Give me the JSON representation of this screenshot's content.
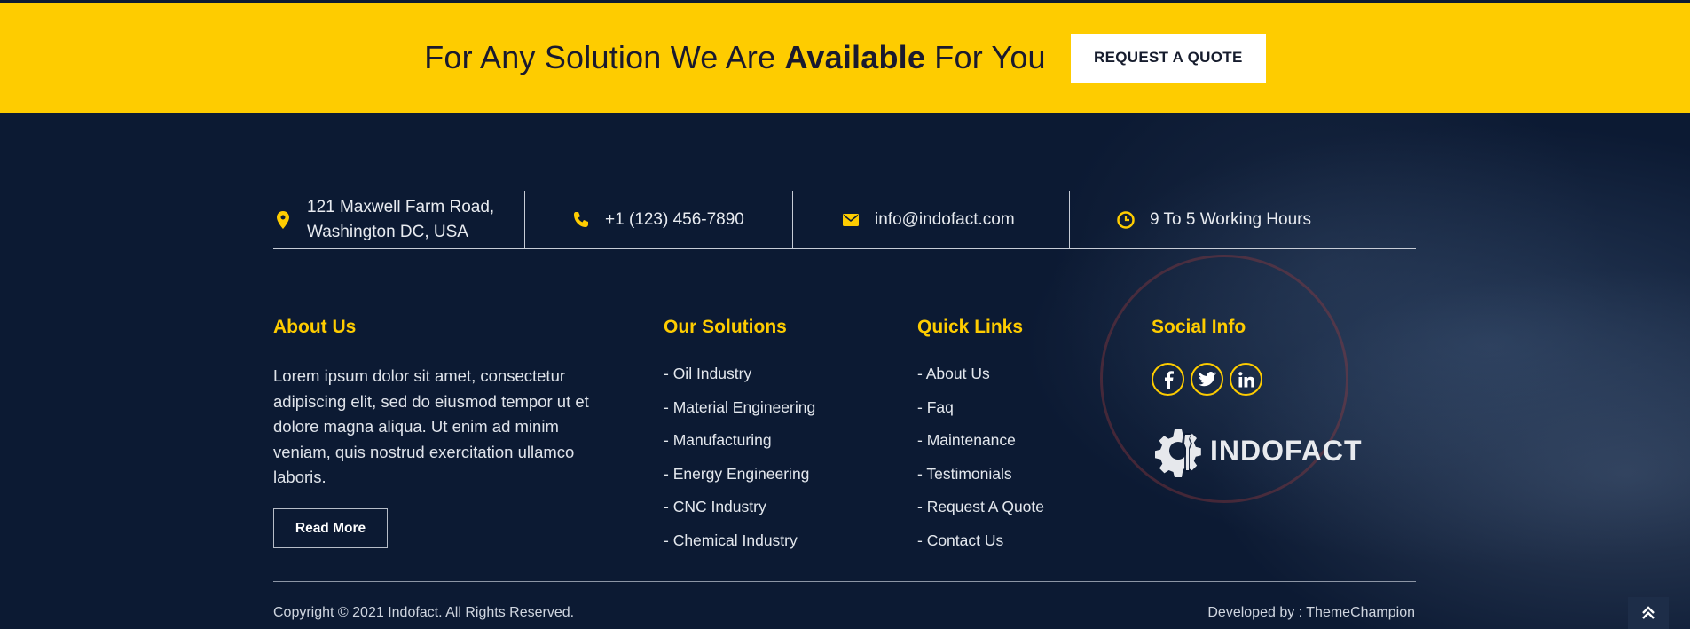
{
  "cta": {
    "text_pre": "For Any Solution We Are ",
    "text_bold": "Available",
    "text_post": " For You",
    "button_label": "REQUEST A QUOTE"
  },
  "contact": {
    "address_line1": "121 Maxwell Farm Road,",
    "address_line2": "Washington DC, USA",
    "phone": "+1 (123) 456-7890",
    "email": "info@indofact.com",
    "hours": "9 To 5 Working Hours"
  },
  "about": {
    "title": "About Us",
    "text": "Lorem ipsum dolor sit amet, consectetur adipiscing elit, sed do eiusmod tempor ut et dolore magna aliqua. Ut enim ad minim veniam, quis nostrud exercitation ullamco laboris.",
    "button_label": "Read More"
  },
  "solutions": {
    "title": "Our Solutions",
    "items": [
      "- Oil Industry",
      "- Material Engineering",
      "- Manufacturing",
      "- Energy Engineering",
      "- CNC Industry",
      "- Chemical Industry"
    ]
  },
  "quick_links": {
    "title": "Quick Links",
    "items": [
      "- About Us",
      "- Faq",
      "- Maintenance",
      "- Testimonials",
      "- Request A Quote",
      "- Contact Us"
    ]
  },
  "social": {
    "title": "Social Info",
    "icons": [
      "facebook-icon",
      "twitter-icon",
      "linkedin-icon"
    ],
    "logo_text": "INDOFACT"
  },
  "bottom": {
    "copyright": "Copyright © 2021 Indofact. All Rights Reserved.",
    "developed": "Developed by : ThemeChampion"
  },
  "colors": {
    "accent": "#fecc00",
    "footer_bg": "#0c1a33"
  }
}
